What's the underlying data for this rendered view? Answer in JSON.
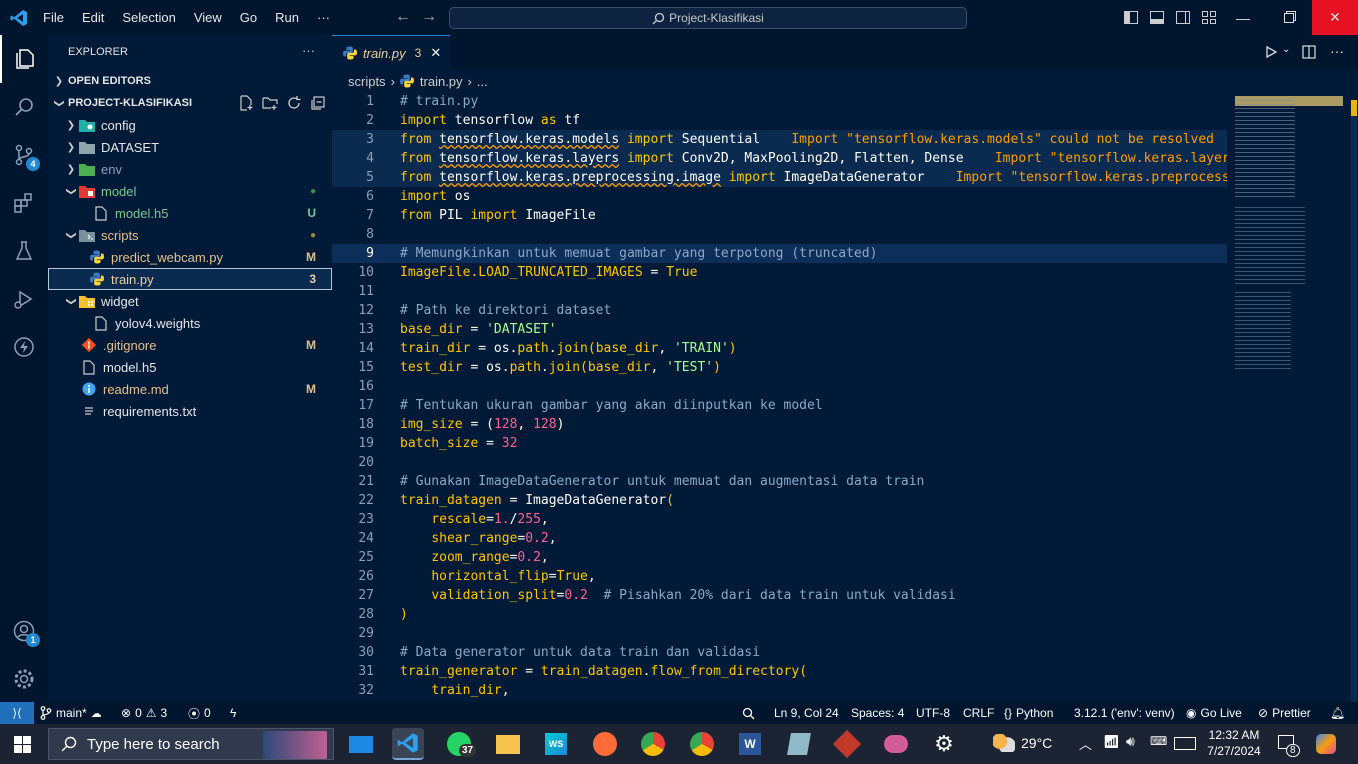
{
  "menu": {
    "file": "File",
    "edit": "Edit",
    "selection": "Selection",
    "view": "View",
    "go": "Go",
    "run": "Run",
    "more": "···"
  },
  "search": {
    "text": "Project-Klasifikasi"
  },
  "badges": {
    "source_control": "4",
    "accounts": "1"
  },
  "explorer": {
    "title": "EXPLORER",
    "more": "···",
    "open_editors": "OPEN EDITORS",
    "project": "PROJECT-KLASIFIKASI",
    "items": [
      {
        "label": "config",
        "deco": ""
      },
      {
        "label": "DATASET",
        "deco": ""
      },
      {
        "label": "env",
        "deco": ""
      },
      {
        "label": "model",
        "deco": "●"
      },
      {
        "label": "model.h5",
        "deco": "U"
      },
      {
        "label": "scripts",
        "deco": "●"
      },
      {
        "label": "predict_webcam.py",
        "deco": "M"
      },
      {
        "label": "train.py",
        "deco": "3"
      },
      {
        "label": "widget",
        "deco": ""
      },
      {
        "label": "yolov4.weights",
        "deco": ""
      },
      {
        "label": ".gitignore",
        "deco": "M"
      },
      {
        "label": "model.h5",
        "deco": ""
      },
      {
        "label": "readme.md",
        "deco": "M"
      },
      {
        "label": "requirements.txt",
        "deco": ""
      }
    ]
  },
  "tab": {
    "label": "train.py",
    "count": "3",
    "close": "✕"
  },
  "breadcrumb": {
    "folder": "scripts",
    "sep": "›",
    "file": "train.py",
    "tail": "..."
  },
  "code_lines": [
    {
      "n": "1"
    },
    {
      "n": "2"
    },
    {
      "n": "3"
    },
    {
      "n": "4"
    },
    {
      "n": "5"
    },
    {
      "n": "6"
    },
    {
      "n": "7"
    },
    {
      "n": "8"
    },
    {
      "n": "9"
    },
    {
      "n": "10"
    },
    {
      "n": "11"
    },
    {
      "n": "12"
    },
    {
      "n": "13"
    },
    {
      "n": "14"
    },
    {
      "n": "15"
    },
    {
      "n": "16"
    },
    {
      "n": "17"
    },
    {
      "n": "18"
    },
    {
      "n": "19"
    },
    {
      "n": "20"
    },
    {
      "n": "21"
    },
    {
      "n": "22"
    },
    {
      "n": "23"
    },
    {
      "n": "24"
    },
    {
      "n": "25"
    },
    {
      "n": "26"
    },
    {
      "n": "27"
    },
    {
      "n": "28"
    },
    {
      "n": "29"
    },
    {
      "n": "30"
    },
    {
      "n": "31"
    },
    {
      "n": "32"
    }
  ],
  "code": {
    "l1": "# train.py",
    "l2a": "import",
    "l2b": " tensorflow ",
    "l2c": "as",
    "l2d": " tf",
    "l3a": "from",
    "l3b": "tensorflow.keras.models",
    "l3c": "import",
    "l3d": " Sequential",
    "l3e": "Import \"tensorflow.keras.models\" could not be resolved",
    "l4a": "from",
    "l4b": "tensorflow.keras.layers",
    "l4c": "import",
    "l4d": " Conv2D, MaxPooling2D, Flatten, Dense",
    "l4e": "Import \"tensorflow.keras.layers\" could not be resolved",
    "l5a": "from",
    "l5b": "tensorflow.keras.preprocessing.image",
    "l5c": "import",
    "l5d": " ImageDataGenerator",
    "l5e": "Import \"tensorflow.keras.preprocessing.image\" could not be resolved",
    "l6a": "import",
    "l6b": " os",
    "l7a": "from",
    "l7b": " PIL ",
    "l7c": "import",
    "l7d": " ImageFile",
    "l9": "# Memungkinkan untuk memuat gambar yang terpotong (truncated)",
    "l10a": "ImageFile",
    "l10b": ".LOAD_TRUNCATED_IMAGES",
    "l10c": " = ",
    "l10d": "True",
    "l12": "# Path ke direktori dataset",
    "l13a": "base_dir",
    "l13b": " = ",
    "l13c": "'DATASET'",
    "l14a": "train_dir",
    "l14b": " = os.",
    "l14c": "path",
    "l14d": ".",
    "l14e": "join",
    "l14f": "(",
    "l14g": "base_dir",
    "l14h": ", ",
    "l14i": "'TRAIN'",
    "l14j": ")",
    "l15a": "test_dir",
    "l15b": " = os.",
    "l15c": "path",
    "l15d": ".",
    "l15e": "join",
    "l15f": "(",
    "l15g": "base_dir",
    "l15h": ", ",
    "l15i": "'TEST'",
    "l15j": ")",
    "l17": "# Tentukan ukuran gambar yang akan diinputkan ke model",
    "l18a": "img_size",
    "l18b": " = (",
    "l18c": "128",
    "l18d": ", ",
    "l18e": "128",
    "l18f": ")",
    "l19a": "batch_size",
    "l19b": " = ",
    "l19c": "32",
    "l21": "# Gunakan ImageDataGenerator untuk memuat dan augmentasi data train",
    "l22a": "train_datagen",
    "l22b": " = ImageDataGenerator",
    "l22c": "(",
    "l23a": "rescale",
    "l23b": "=",
    "l23c": "1.",
    "l23d": "/",
    "l23e": "255",
    "l23f": ",",
    "l24a": "shear_range",
    "l24b": "=",
    "l24c": "0.2",
    "l24d": ",",
    "l25a": "zoom_range",
    "l25b": "=",
    "l25c": "0.2",
    "l25d": ",",
    "l26a": "horizontal_flip",
    "l26b": "=",
    "l26c": "True",
    "l26d": ",",
    "l27a": "validation_split",
    "l27b": "=",
    "l27c": "0.2",
    "l27d": "  # Pisahkan 20% dari data train untuk validasi",
    "l28": ")",
    "l30": "# Data generator untuk data train dan validasi",
    "l31a": "train_generator",
    "l31b": " = ",
    "l31c": "train_datagen",
    "l31d": ".",
    "l31e": "flow_from_directory",
    "l31f": "(",
    "l32a": "train_dir",
    "l32b": ","
  },
  "status": {
    "branch": "main*",
    "errors": "0",
    "warnings": "3",
    "ports": "0",
    "position": "Ln 9, Col 24",
    "spaces": "Spaces: 4",
    "encoding": "UTF-8",
    "eol": "CRLF",
    "language": "Python",
    "interpreter": "3.12.1 ('env': venv)",
    "golive": "Go Live",
    "prettier": "Prettier"
  },
  "taskbar": {
    "search_placeholder": "Type here to search",
    "whatsapp_count": "37",
    "weather": "29°C",
    "time": "12:32 AM",
    "date": "7/27/2024",
    "notif_count": "8"
  },
  "colors": {
    "accent": "#1f8ad2",
    "keyword": "#ffc600",
    "string": "#a5ff90",
    "number": "#ff628c",
    "warning": "#ff9d00"
  }
}
